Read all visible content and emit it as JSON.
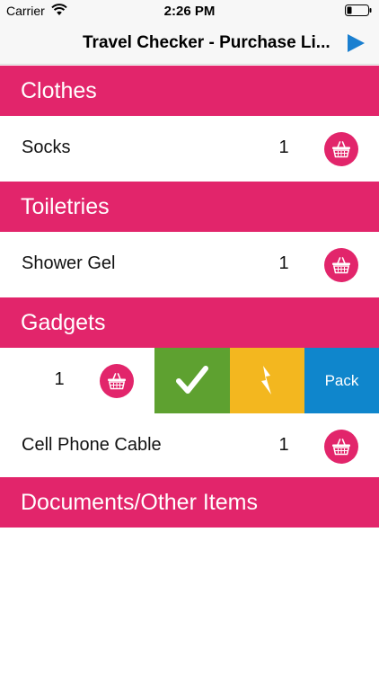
{
  "status": {
    "carrier": "Carrier",
    "time": "2:26 PM"
  },
  "nav": {
    "title": "Travel Checker - Purchase Li..."
  },
  "sections": [
    {
      "title": "Clothes",
      "items": [
        {
          "name": "Socks",
          "qty": "1"
        }
      ]
    },
    {
      "title": "Toiletries",
      "items": [
        {
          "name": "Shower Gel",
          "qty": "1"
        }
      ]
    },
    {
      "title": "Gadgets",
      "items": [
        {
          "name": "",
          "qty": "1"
        },
        {
          "name": "Cell Phone Cable",
          "qty": "1"
        }
      ]
    },
    {
      "title": "Documents/Other Items",
      "items": []
    }
  ],
  "swipe_actions": {
    "pack_label": "Pack"
  },
  "colors": {
    "accent": "#e2256b",
    "check": "#5ea130",
    "bolt": "#f3b71f",
    "pack": "#0f86cc",
    "play": "#1a7fd0"
  },
  "icons": [
    "wifi-icon",
    "battery-icon",
    "play-icon",
    "basket-icon",
    "checkmark-icon",
    "bolt-icon"
  ]
}
